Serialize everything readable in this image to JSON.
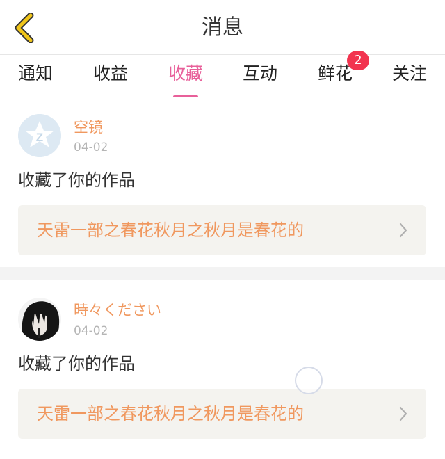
{
  "header": {
    "title": "消息",
    "back_icon": "chevron-left-icon",
    "accent": "#f0c51a"
  },
  "tabs": [
    {
      "label": "通知",
      "active": false
    },
    {
      "label": "收益",
      "active": false
    },
    {
      "label": "收藏",
      "active": true
    },
    {
      "label": "互动",
      "active": false
    },
    {
      "label": "鲜花",
      "active": false,
      "badge": "2"
    },
    {
      "label": "关注",
      "active": false
    }
  ],
  "colors": {
    "active_tab": "#e8609a",
    "name": "#f0985f",
    "badge": "#f2334f"
  },
  "messages": [
    {
      "user": "空镜",
      "date": "04-02",
      "action": "收藏了你的作品",
      "work_title": "天雷一部之春花秋月之秋月是春花的",
      "avatar_icon": "default-avatar-icon"
    },
    {
      "user": "時々ください",
      "date": "04-02",
      "action": "收藏了你的作品",
      "work_title": "天雷一部之春花秋月之秋月是春花的",
      "avatar_icon": "user-photo"
    }
  ]
}
